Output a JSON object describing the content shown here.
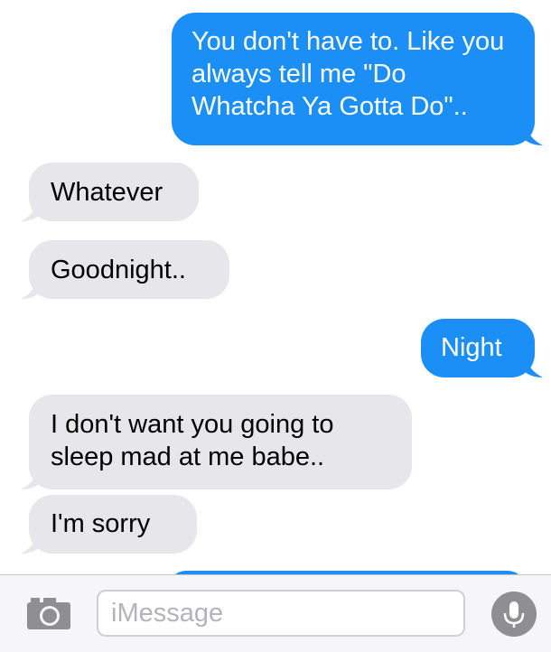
{
  "messages": [
    {
      "id": "b1",
      "from": "me",
      "text": "You don't have to. Like you always tell me \"Do Whatcha Ya Gotta Do\".."
    },
    {
      "id": "b2",
      "from": "them",
      "text": "Whatever"
    },
    {
      "id": "b3",
      "from": "them",
      "text": "Goodnight.."
    },
    {
      "id": "b4",
      "from": "me",
      "text": "Night"
    },
    {
      "id": "b5",
      "from": "them",
      "text": "I don't want you going to sleep mad at me babe.."
    },
    {
      "id": "b6",
      "from": "them",
      "text": "I'm sorry"
    },
    {
      "id": "b7",
      "from": "me",
      "text": ""
    }
  ],
  "input": {
    "placeholder": "iMessage",
    "value": ""
  },
  "icons": {
    "camera": "camera-icon",
    "microphone": "microphone-icon"
  },
  "colors": {
    "sent_bubble": "#1b8ff6",
    "received_bubble": "#e6e6eb",
    "sent_text": "#ffffff",
    "received_text": "#000000",
    "icon_gray": "#8e8e93"
  }
}
